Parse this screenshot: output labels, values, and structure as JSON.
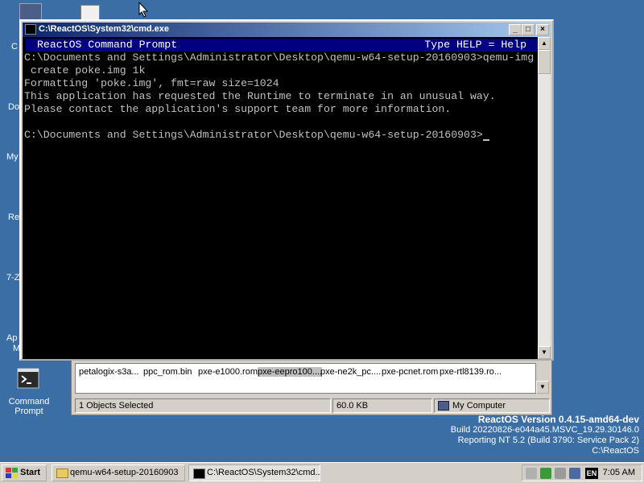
{
  "desktop": {
    "icons": [
      {
        "label": "Command Prompt"
      }
    ],
    "partial_labels": [
      "C",
      "Do",
      "My",
      "Re",
      "7-Z",
      "Ap",
      "M"
    ]
  },
  "cmd_window": {
    "title": "C:\\ReactOS\\System32\\cmd.exe",
    "buttons": {
      "minimize": "_",
      "maximize": "□",
      "close": "×"
    },
    "header_left": "ReactOS Command Prompt",
    "header_right": "Type HELP = Help",
    "lines": [
      "C:\\Documents and Settings\\Administrator\\Desktop\\qemu-w64-setup-20160903>qemu-img",
      " create poke.img 1k",
      "Formatting 'poke.img', fmt=raw size=1024",
      "This application has requested the Runtime to terminate in an unusual way.",
      "Please contact the application's support team for more information.",
      "",
      "C:\\Documents and Settings\\Administrator\\Desktop\\qemu-w64-setup-20160903>"
    ]
  },
  "explorer": {
    "files": [
      {
        "name": "petalogix-s3a...",
        "selected": false
      },
      {
        "name": "ppc_rom.bin",
        "selected": false
      },
      {
        "name": "pxe-e1000.rom",
        "selected": false
      },
      {
        "name": "pxe-eepro100....",
        "selected": true
      },
      {
        "name": "pxe-ne2k_pc....",
        "selected": false
      },
      {
        "name": "pxe-pcnet.rom",
        "selected": false
      },
      {
        "name": "pxe-rtl8139.ro...",
        "selected": false
      }
    ],
    "status": {
      "selection": "1 Objects Selected",
      "size": "60.0 KB",
      "location": "My Computer"
    }
  },
  "version_info": {
    "line1": "ReactOS Version 0.4.15-amd64-dev",
    "line2": "Build 20220826-e044a45.MSVC_19.29.30146.0",
    "line3": "Reporting NT 5.2 (Build 3790: Service Pack 2)",
    "line4": "C:\\ReactOS"
  },
  "taskbar": {
    "start_label": "Start",
    "tasks": [
      {
        "label": "qemu-w64-setup-20160903",
        "icon": "folder-icon"
      },
      {
        "label": "C:\\ReactOS\\System32\\cmd....",
        "icon": "console-icon"
      }
    ],
    "tray": {
      "language": "EN",
      "clock": "7:05 AM"
    }
  },
  "colors": {
    "desktop": "#3a6ea5",
    "title_active": "#0a246a",
    "console_bg": "#000000",
    "console_fg": "#c0c0c0",
    "console_bar": "#000080"
  }
}
